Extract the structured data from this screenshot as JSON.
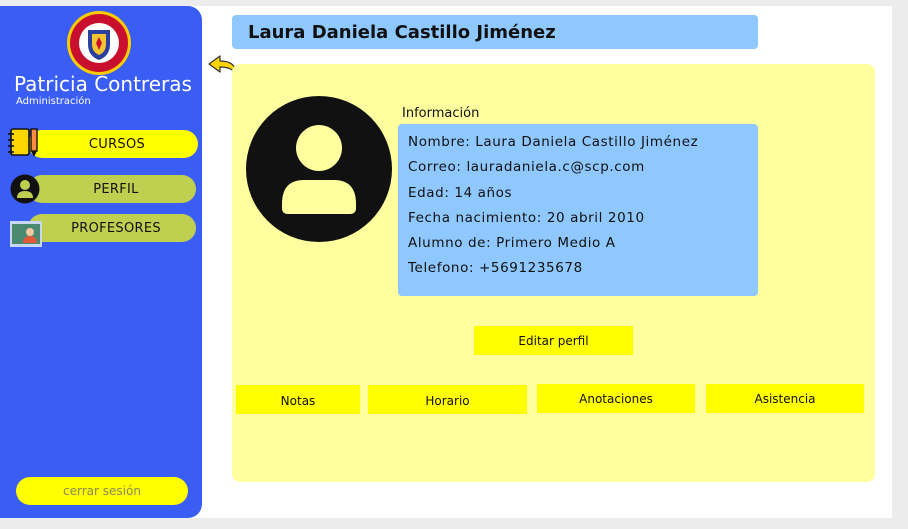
{
  "sidebar": {
    "logo_icon": "school-crest-icon",
    "user_name": "Patricia Contreras",
    "user_role": "Administración",
    "items": [
      {
        "label": "CURSOS",
        "icon": "notebook-pencil-icon"
      },
      {
        "label": "PERFIL",
        "icon": "user-avatar-icon"
      },
      {
        "label": "PROFESORES",
        "icon": "teacher-board-icon"
      }
    ],
    "logout_label": "cerrar sesión"
  },
  "back_icon": "back-arrow-icon",
  "student": {
    "header_name": "Laura Daniela Castillo Jiménez",
    "avatar_icon": "user-avatar-icon",
    "info_title": "Información",
    "info_lines": [
      "Nombre: Laura Daniela Castillo Jiménez",
      "Correo: lauradaniela.c@scp.com",
      "Edad: 14 años",
      "Fecha nacimiento: 20 abril 2010",
      "Alumno de: Primero Medio A",
      "Telefono: +5691235678"
    ],
    "edit_label": "Editar perfil"
  },
  "tabs": [
    "Notas",
    "Horario",
    "Anotaciones",
    "Asistencia"
  ],
  "colors": {
    "sidebar": "#3a5df5",
    "accent_yellow": "#ffff00",
    "panel": "#ffff9f",
    "info_blue": "#8fc8ff",
    "nav_inactive": "#bfcf4f"
  }
}
